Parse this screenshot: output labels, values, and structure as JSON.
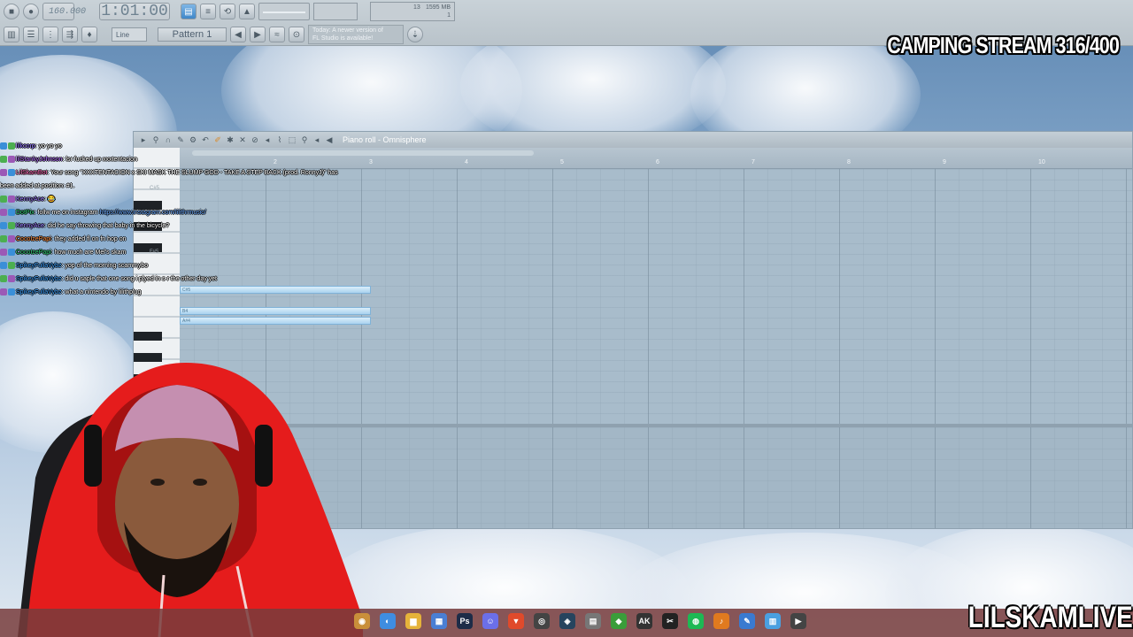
{
  "toolbar": {
    "tempo": "160.000",
    "time": "1:01:00",
    "cpu_value": "13",
    "memory": "1595 MB",
    "poly": "1",
    "snap": "Line",
    "pattern": "Pattern 1",
    "news_line1": "Today: A newer version of",
    "news_line2": "FL Studio is available!"
  },
  "overlay": {
    "title": "CAMPING STREAM 316/400",
    "channel": "LILSKAMLIVE"
  },
  "piano_roll": {
    "title": "Piano roll - Omnisphere",
    "bar_numbers": [
      "2",
      "3",
      "4",
      "5",
      "6",
      "7",
      "8",
      "9",
      "10"
    ],
    "key_labels": [
      "C#5",
      "F#5"
    ],
    "note_labels": [
      "C#5",
      "B4",
      "A#4"
    ]
  },
  "chat": [
    {
      "user": "lilkcorp",
      "msg": ": yo yo yo",
      "color": "#8a6cff"
    },
    {
      "user": "lilStankyJohnson",
      "msg": ": lsr fucked up xxxtentacion",
      "color": "#b36bff"
    },
    {
      "user": "LilSkamBot",
      "msg": ": Your song \"XXXTENTACION x SKI MASK THE SLUMP GOD - TAKE A STEP BACK (prod. RonnyJ)\" has",
      "color": "#ff69b4"
    },
    {
      "user": "",
      "msg": "been added at position: #1.",
      "color": "#ffffff"
    },
    {
      "user": "KennyAce",
      "msg": ": 😂",
      "color": "#9a7cff"
    },
    {
      "user": "DotPix",
      "msg": ": follw me on instagram ",
      "link": "https://www.instagram.com/lilithrmusic/",
      "color": "#2ecc71"
    },
    {
      "user": "KennyAce",
      "msg": ": did he say throwing that baby in the bicycle?",
      "color": "#9a7cff"
    },
    {
      "user": "CocoIzePapi",
      "msg": ": they added fl on fn hop on",
      "color": "#ff8c3a"
    },
    {
      "user": "CocoIzePapi",
      "msg": ": how much are Mel's skam",
      "color": "#2ecc71"
    },
    {
      "user": "SpikeyFullaVybz",
      "msg": ": yop of the morning scammybo",
      "color": "#3aa0ff"
    },
    {
      "user": "SpikeyFullaVybz",
      "msg": ": did u saple that one song i plyed in s r the other day yet",
      "color": "#3aa0ff"
    },
    {
      "user": "SpikeyFullaVybz",
      "msg": ": what a nintendo by lilithplug",
      "color": "#3aa0ff"
    }
  ],
  "taskbar_icons": [
    {
      "name": "explorer-app-icon",
      "glyph": "◉",
      "color": "#c98f3a"
    },
    {
      "name": "chrome-app-icon",
      "glyph": "◐",
      "color": "#3f8de0"
    },
    {
      "name": "folder-app-icon",
      "glyph": "▆",
      "color": "#e5b33a"
    },
    {
      "name": "store-app-icon",
      "glyph": "▦",
      "color": "#4a7fd4"
    },
    {
      "name": "photoshop-app-icon",
      "glyph": "Ps",
      "color": "#1d2c48"
    },
    {
      "name": "discord-app-icon",
      "glyph": "☺",
      "color": "#6b6fe8"
    },
    {
      "name": "brave-app-icon",
      "glyph": "▼",
      "color": "#e04a2b"
    },
    {
      "name": "obs-app-icon",
      "glyph": "◎",
      "color": "#444"
    },
    {
      "name": "steam-app-icon",
      "glyph": "◈",
      "color": "#26445e"
    },
    {
      "name": "notes-app-icon",
      "glyph": "▤",
      "color": "#777"
    },
    {
      "name": "xbox-app-icon",
      "glyph": "◆",
      "color": "#3a9d3a"
    },
    {
      "name": "ak-app-icon",
      "glyph": "AK",
      "color": "#333"
    },
    {
      "name": "capcut-app-icon",
      "glyph": "✂",
      "color": "#222"
    },
    {
      "name": "spotify-app-icon",
      "glyph": "◍",
      "color": "#1db954"
    },
    {
      "name": "flstudio-app-icon",
      "glyph": "♪",
      "color": "#e07a1f"
    },
    {
      "name": "editor-app-icon",
      "glyph": "✎",
      "color": "#3a7ad0"
    },
    {
      "name": "notepad-app-icon",
      "glyph": "▥",
      "color": "#4aa0e0"
    },
    {
      "name": "media-player-icon",
      "glyph": "▶",
      "color": "#444"
    }
  ]
}
